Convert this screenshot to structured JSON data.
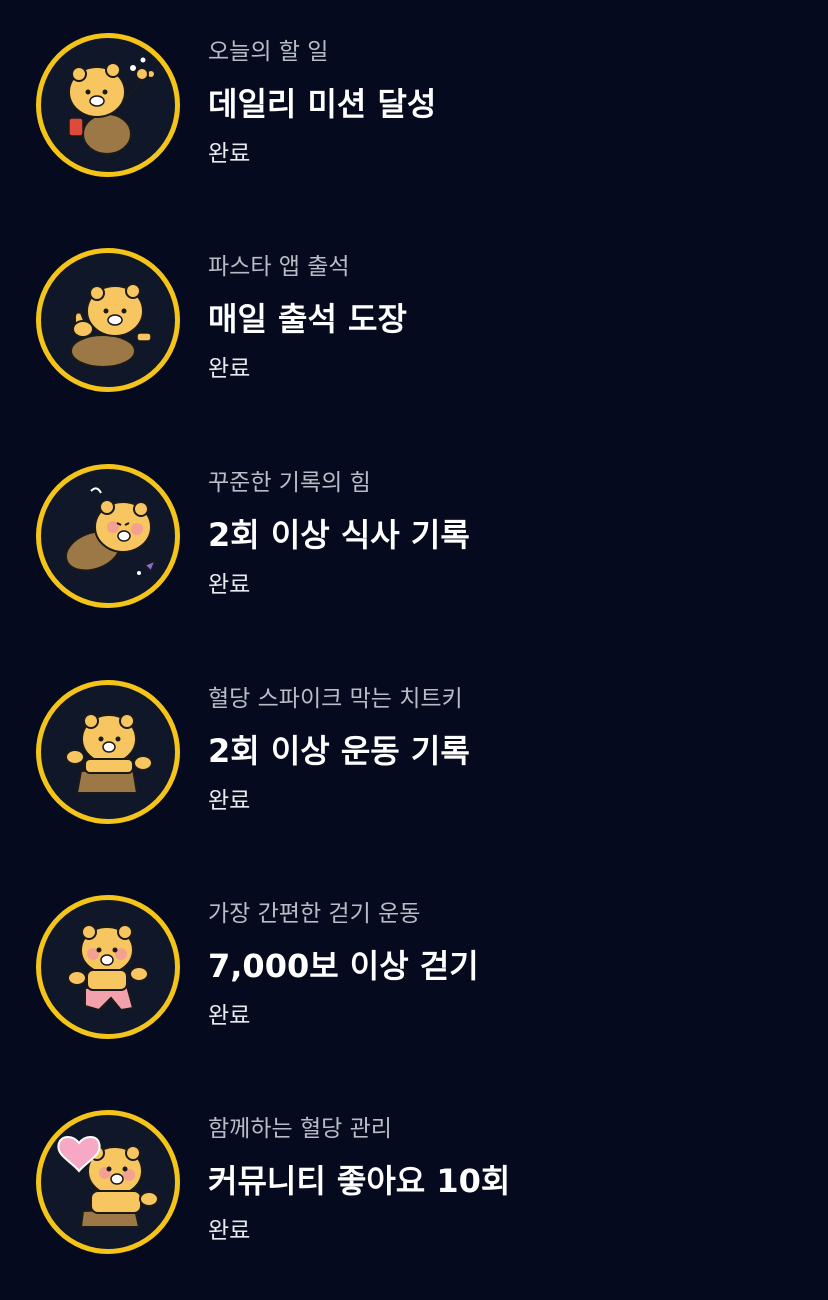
{
  "missions": [
    {
      "subtitle": "오늘의 할 일",
      "title": "데일리 미션 달성",
      "status": "완료",
      "icon": "bear-dancing-icon"
    },
    {
      "subtitle": "파스타 앱 출석",
      "title": "매일 출석 도장",
      "status": "완료",
      "icon": "bear-thumbs-up-icon"
    },
    {
      "subtitle": "꾸준한 기록의 힘",
      "title": "2회 이상 식사 기록",
      "status": "완료",
      "icon": "bear-rolling-icon"
    },
    {
      "subtitle": "혈당 스파이크 막는 치트키",
      "title": "2회 이상 운동 기록",
      "status": "완료",
      "icon": "bear-exercise-icon"
    },
    {
      "subtitle": "가장 간편한 걷기 운동",
      "title": "7,000보 이상 걷기",
      "status": "완료",
      "icon": "bear-walking-icon"
    },
    {
      "subtitle": "함께하는 혈당 관리",
      "title": "커뮤니티 좋아요 10회",
      "status": "완료",
      "icon": "bear-heart-icon"
    }
  ],
  "colors": {
    "background": "#050a1e",
    "badge_ring": "#f5c418",
    "bear_body": "#f7c660",
    "pants_brown": "#9b7845",
    "pants_pink": "#f2a1ad"
  }
}
